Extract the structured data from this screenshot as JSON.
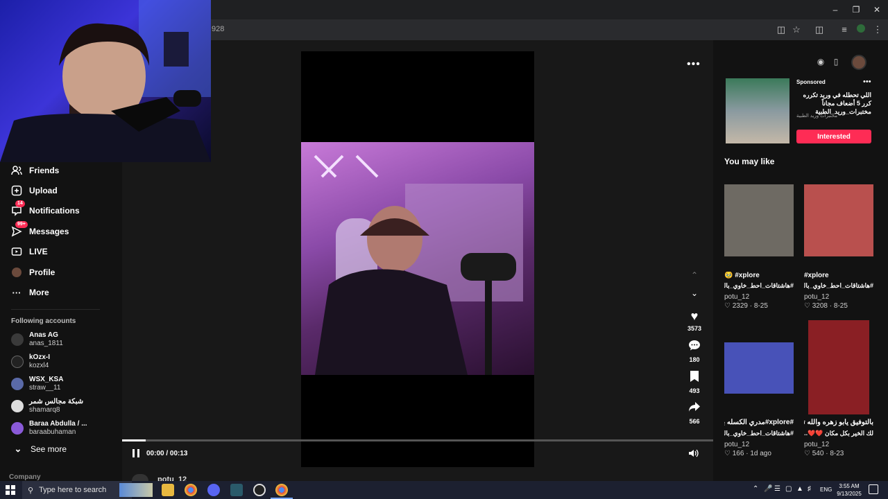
{
  "browser": {
    "url_fragment": "928",
    "window_controls": [
      "minimize",
      "restore",
      "close"
    ]
  },
  "sidebar": {
    "items": [
      {
        "label": "Friends",
        "icon": "friends-icon",
        "badge": ""
      },
      {
        "label": "Upload",
        "icon": "upload-icon",
        "badge": ""
      },
      {
        "label": "Notifications",
        "icon": "inbox-icon",
        "badge": "14"
      },
      {
        "label": "Messages",
        "icon": "messages-icon",
        "badge": "99+"
      },
      {
        "label": "LIVE",
        "icon": "live-icon",
        "badge": ""
      },
      {
        "label": "Profile",
        "icon": "profile-avatar",
        "badge": ""
      },
      {
        "label": "More",
        "icon": "more-icon",
        "badge": ""
      }
    ],
    "following_title": "Following accounts",
    "following": [
      {
        "name": "Anas AG",
        "user": "anas_1811"
      },
      {
        "name": "kOzx-I",
        "user": "kozxl4"
      },
      {
        "name": "WSX_KSA",
        "user": "straw__11"
      },
      {
        "name": "شبكة مجالس شمر",
        "user": "shamarq8"
      },
      {
        "name": "Baraa Abdulla / ...",
        "user": "baraabuhaman"
      }
    ],
    "see_more": "See more",
    "company": "Company"
  },
  "player": {
    "time": "00:00 / 00:13",
    "progress": 0.04,
    "author_peek": "potu_12",
    "actions": [
      {
        "icon": "heart-icon",
        "count": "3573"
      },
      {
        "icon": "comment-icon",
        "count": "180"
      },
      {
        "icon": "bookmark-icon",
        "count": "493"
      },
      {
        "icon": "share-icon",
        "count": "566"
      }
    ]
  },
  "ad": {
    "sponsored": "Sponsored",
    "text": "اللي تحطله في وريد تكرره كرر 5 أضعاف مجاناً مختبرات_وريد_الطبية",
    "brand": "مختبرات وريد الطبية",
    "cta": "Interested"
  },
  "recommend": {
    "title": "You may like",
    "cards": [
      {
        "tag": "🥹 #xplore",
        "caption": "#هاشتاقات_احط_خاوي_بالي...",
        "author": "potu_12",
        "likes": "2329",
        "date": "8-25",
        "thumb": "#6e6a63"
      },
      {
        "tag": "#xplore",
        "caption": "#هاشتاقات_احط_خاوي_بالي...",
        "author": "potu_12",
        "likes": "3208",
        "date": "8-25",
        "thumb": "#b9504e"
      },
      {
        "tag": "#xplore#مدري الكسله باربع ؟",
        "caption": "#هاشتاقات_احط_خاوي_بالي...",
        "author": "potu_12",
        "likes": "166",
        "date": "1d ago",
        "thumb": "#4852b8"
      },
      {
        "tag": "بالتوفيق يابو زهره والله تتعدا",
        "caption": "لك الخير بكل مكان ❤️❤️...",
        "author": "potu_12",
        "likes": "540",
        "date": "8-23",
        "thumb": "#8a1f24"
      }
    ]
  },
  "taskbar": {
    "search_placeholder": "Type here to search",
    "lang": "ENG",
    "time": "3:55 AM",
    "date": "9/13/2025"
  },
  "colors": {
    "accent": "#fe2c55",
    "page_bg": "#121212"
  }
}
